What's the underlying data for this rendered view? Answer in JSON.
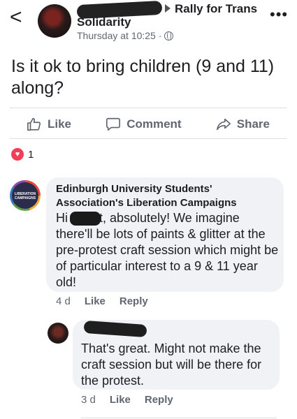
{
  "header": {
    "back_glyph": "<",
    "group_name_line1": "Rally for Trans",
    "group_name_line2": "Solidarity",
    "timestamp": "Thursday at 10:25 ·",
    "more_glyph": "•••"
  },
  "post": {
    "text": "Is it ok to bring children (9 and 11) along?"
  },
  "actions": {
    "like": "Like",
    "comment": "Comment",
    "share": "Share"
  },
  "reactions": {
    "count": "1"
  },
  "comments": [
    {
      "author": "Edinburgh University Students' Association's Liberation Campaigns",
      "avatar_text": "LIBERATION CAMPAIGNS",
      "text_prefix": "Hi",
      "text_after_redaction": "t, absolutely! We imagine there'll be lots of paints & glitter at the pre-protest craft session which might be of particular interest to a 9 & 11 year old!",
      "age": "4 d",
      "like": "Like",
      "reply": "Reply"
    },
    {
      "text": "That's great.  Might not make the craft session but will be there for the protest.",
      "age": "3 d",
      "like": "Like",
      "reply": "Reply"
    }
  ]
}
